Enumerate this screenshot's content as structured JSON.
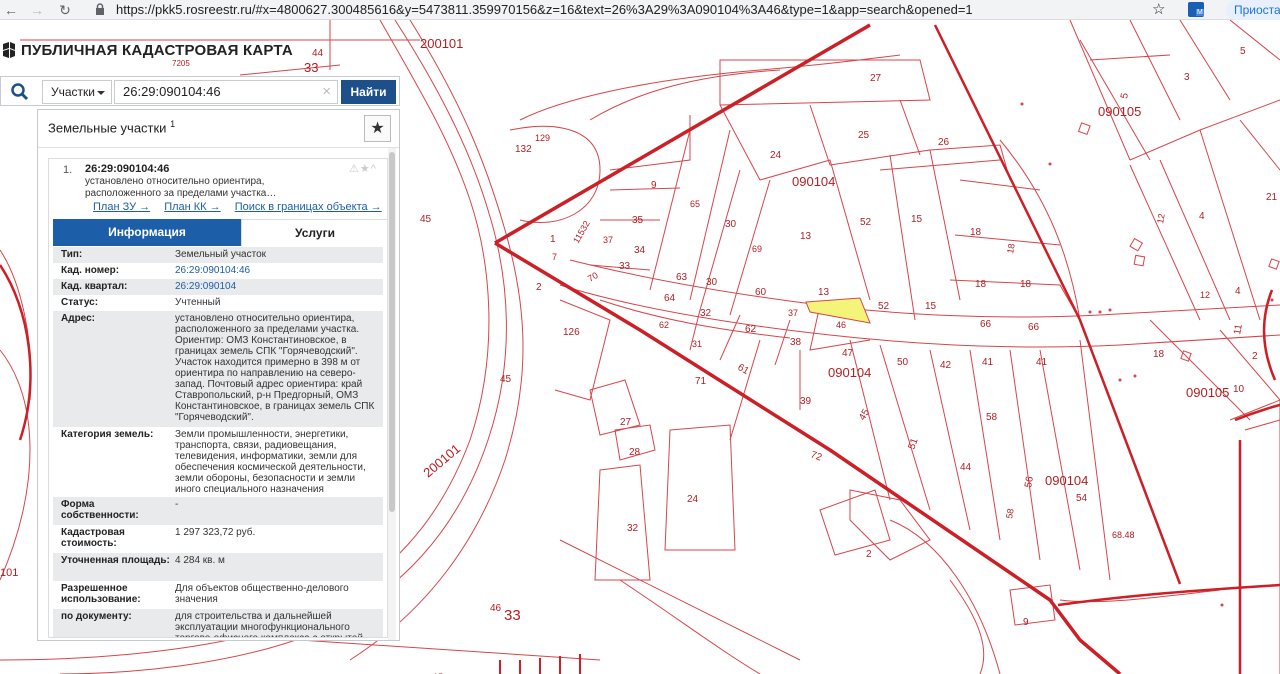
{
  "browser": {
    "url": "https://pkk5.rosreestr.ru/#x=4800627.300485616&y=5473811.359970156&z=16&text=26%3A29%3A090104%3A46&type=1&app=search&opened=1",
    "apps_label": "Приостан"
  },
  "app": {
    "title": "ПУБЛИЧНАЯ КАДАСТРОВАЯ КАРТА"
  },
  "search": {
    "type_label": "Участки",
    "query": "26:29:090104:46",
    "find_label": "Найти"
  },
  "panel": {
    "title": "Земельные участки",
    "title_sup": "1"
  },
  "result": {
    "number": "1.",
    "cad_number": "26:29:090104:46",
    "short_desc": "установлено относительно ориентира, расположенного за пределами участка…",
    "links": [
      "План ЗУ →",
      "План КК →",
      "Поиск в границах объекта →"
    ],
    "tabs": [
      "Информация",
      "Услуги"
    ],
    "rows": [
      {
        "k": "Тип:",
        "v": "Земельный участок"
      },
      {
        "k": "Кад. номер:",
        "v": "26:29:090104:46"
      },
      {
        "k": "Кад. квартал:",
        "v": "26:29:090104"
      },
      {
        "k": "Статус:",
        "v": "Учтенный"
      },
      {
        "k": "Адрес:",
        "v": "установлено относительно ориентира, расположенного за пределами участка. Ориентир: ОМЗ Константиновское, в границах земель СПК \"Горячеводский\". Участок находится примерно в 398 м от ориентира по направлению на северо-запад. Почтовый адрес ориентира: край Ставропольский, р-н Предгорный, ОМЗ Константиновское, в границах земель СПК \"Горячеводский\"."
      },
      {
        "k": "Категория земель:",
        "v": "Земли промышленности, энергетики, транспорта, связи, радиовещания, телевидения, информатики, земли для обеспечения космической деятельности, земли обороны, безопасности и земли иного специального назначения"
      },
      {
        "k": "Форма собственности:",
        "v": "-"
      },
      {
        "k": "Кадастровая стоимость:",
        "v": "1 297 323,72 руб."
      },
      {
        "k": "Уточненная площадь:",
        "v": "4 284 кв. м"
      },
      {
        "k": "Разрешенное использование:",
        "v": "Для объектов общественно-делового значения"
      },
      {
        "k": "по документу:",
        "v": "для строительства и дальнейшей эксплуатации многофункционального торгово-офисного комплекса с открытой"
      }
    ]
  },
  "map": {
    "labels": [
      "200101",
      "44",
      "7205",
      "33",
      "132",
      "129",
      "45",
      "2",
      "1",
      "7",
      "11532",
      "37",
      "33",
      "70",
      "126",
      "45",
      "200101",
      "101",
      "46",
      "33",
      "15",
      "27",
      "25",
      "26",
      "24",
      "9",
      "65",
      "35",
      "34",
      "30",
      "69",
      "13",
      "52",
      "15",
      "63",
      "30",
      "60",
      "13",
      "64",
      "32",
      "62",
      "52",
      "15",
      "62",
      "31",
      "37",
      "46",
      "47",
      "38",
      "61",
      "71",
      "39",
      "45",
      "51",
      "72",
      "50",
      "42",
      "41",
      "41",
      "44",
      "58",
      "56",
      "58",
      "54",
      "68.48",
      "090104",
      "090104",
      "090104",
      "27",
      "28",
      "32",
      "24",
      "2",
      "9",
      "5",
      "3",
      "5",
      "090105",
      "4",
      "12",
      "12",
      "4",
      "21",
      "18",
      "18",
      "18",
      "18",
      "66",
      "66",
      "11",
      "18",
      "10",
      "090105",
      "2"
    ],
    "colors": {
      "line": "#d9444a",
      "bold": "#cc1f26",
      "selected_fill": "#f4f47a"
    }
  }
}
